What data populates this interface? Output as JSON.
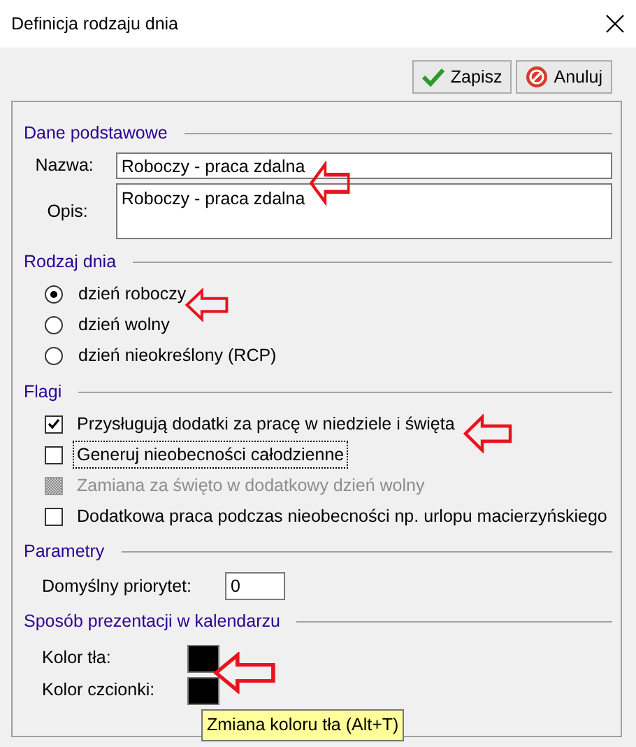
{
  "window": {
    "title": "Definicja rodzaju dnia"
  },
  "toolbar": {
    "buttons": [
      {
        "label": "Zapisz",
        "kind": "save"
      },
      {
        "label": "Anuluj",
        "kind": "cancel"
      }
    ]
  },
  "sections": [
    {
      "title": "Dane podstawowe",
      "kind": "fields",
      "fields": [
        {
          "label": "Nazwa:",
          "value": "Roboczy - praca zdalna",
          "kind": "line"
        },
        {
          "label": "Opis:",
          "value": "Roboczy - praca zdalna",
          "kind": "multiline"
        }
      ]
    },
    {
      "title": "Rodzaj dnia",
      "kind": "radios",
      "options": [
        {
          "label": "dzień roboczy",
          "selected": true
        },
        {
          "label": "dzień wolny",
          "selected": false
        },
        {
          "label": "dzień nieokreślony (RCP)",
          "selected": false
        }
      ]
    },
    {
      "title": "Flagi",
      "kind": "checks",
      "options": [
        {
          "label": "Przysługują dodatki za pracę w niedziele i święta",
          "checked": true,
          "disabled": false,
          "focused": false
        },
        {
          "label": "Generuj nieobecności całodzienne",
          "checked": false,
          "disabled": false,
          "focused": true
        },
        {
          "label": "Zamiana za święto w dodatkowy dzień wolny",
          "checked": false,
          "disabled": true,
          "focused": false
        },
        {
          "label": "Dodatkowa praca podczas nieobecności np. urlopu macierzyńskiego",
          "checked": false,
          "disabled": false,
          "focused": false
        }
      ]
    },
    {
      "title": "Parametry",
      "kind": "fields",
      "fields": [
        {
          "label": "Domyślny priorytet:",
          "value": "0",
          "kind": "short"
        }
      ]
    },
    {
      "title": "Sposób prezentacji w kalendarzu",
      "kind": "colors",
      "swatches": [
        {
          "label": "Kolor tła:",
          "color": "#000000"
        },
        {
          "label": "Kolor czcionki:",
          "color": "#000000"
        }
      ]
    }
  ],
  "tooltip": {
    "text": "Zmiana koloru tła (Alt+T)"
  }
}
